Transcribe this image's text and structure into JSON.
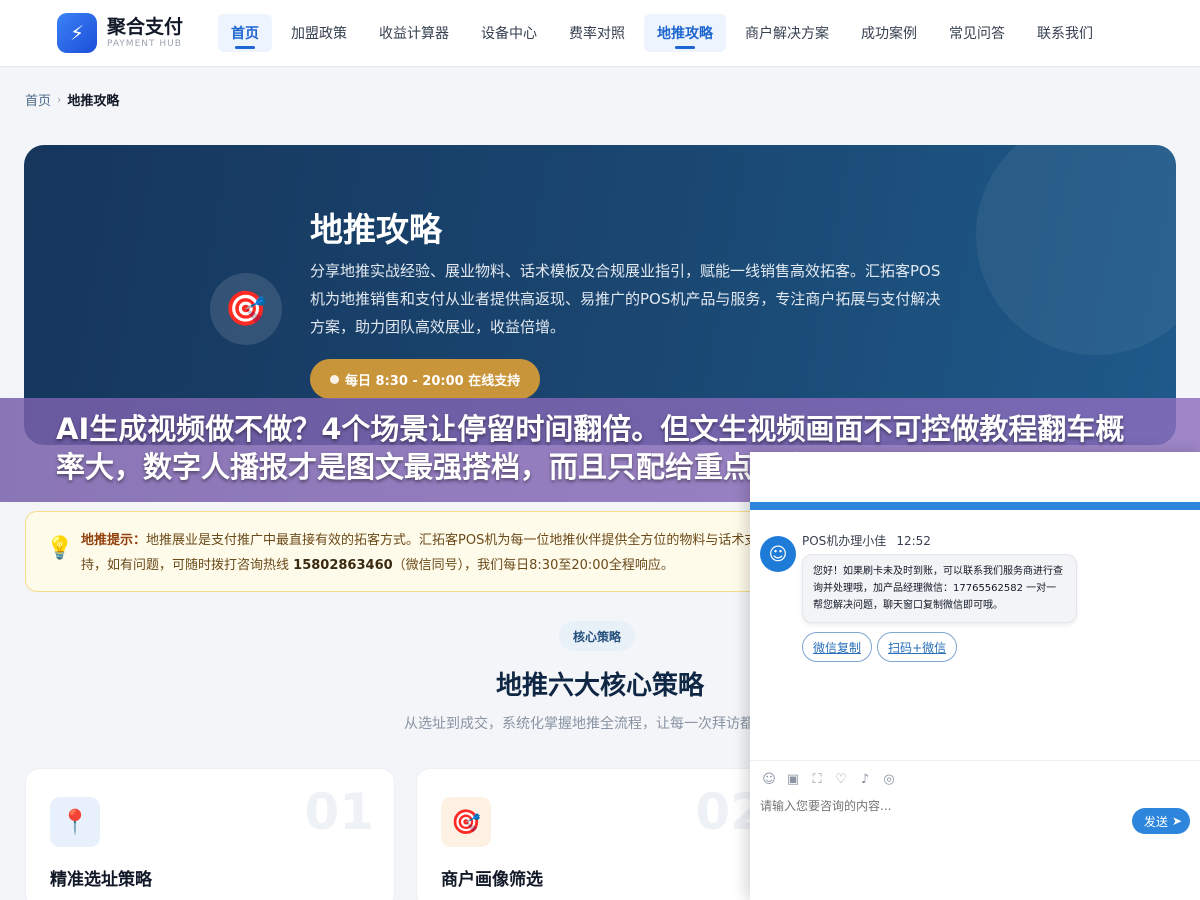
{
  "header": {
    "logo_glyph": "⚡",
    "logo_title": "聚合支付",
    "logo_subtitle": "PAYMENT HUB",
    "nav": [
      {
        "label": "首页",
        "active": true
      },
      {
        "label": "加盟政策"
      },
      {
        "label": "收益计算器"
      },
      {
        "label": "设备中心"
      },
      {
        "label": "费率对照"
      },
      {
        "label": "地推攻略",
        "active": true
      },
      {
        "label": "商户解决方案"
      },
      {
        "label": "成功案例"
      },
      {
        "label": "常见问答"
      },
      {
        "label": "联系我们"
      }
    ]
  },
  "breadcrumb": {
    "home": "首页",
    "separator": "›",
    "current": "地推攻略"
  },
  "hero": {
    "icon": "target-icon",
    "title": "地推攻略",
    "description": "分享地推实战经验、展业物料、话术模板及合规展业指引，赋能一线销售高效拓客。汇拓客POS机为地推销售和支付从业者提供高返现、易推广的POS机产品与服务，专注商户拓展与支付解决方案，助力团队高效展业，收益倍增。",
    "button_label": "每日 8:30 - 20:00 在线支持"
  },
  "overlay": {
    "text": "AI生成视频做不做？4个场景让停留时间翻倍。但文生视频画面不可控做教程翻车概率大，数字人播报才是图文最强搭档，而且只配给重点内容不"
  },
  "notice": {
    "icon": "💡",
    "label": "地推提示：",
    "text_1": "地推展业是支付推广中最直接有效的拓客方式。汇拓客POS机为每一位地推伙伴提供全方位的物料与话术支持，如有问题，可随时拨打咨询热线",
    "phone": "15802863460",
    "text_2": "（微信同号），我们每日8:30至20:00全程响应。"
  },
  "section": {
    "tag": "核心策略",
    "title": "地推六大核心策略",
    "subtitle": "从选址到成交，系统化掌握地推全流程，让每一次拜访都有收获"
  },
  "cards": [
    {
      "num": "01",
      "icon": "📍",
      "title": "精准选址策略"
    },
    {
      "num": "02",
      "icon": "🎯",
      "title": "商户画像筛选"
    }
  ],
  "chat": {
    "close": "✕",
    "agent_avatar": "☺",
    "agent_name": "POS机办理小佳",
    "time": "12:52",
    "message": "您好！如果刷卡未及时到账，可以联系我们服务商进行查询并处理哦，加产品经理微信：17765562582 一对一帮您解决问题，聊天窗口复制微信即可哦。",
    "quick_replies": [
      "微信复制",
      "扫码+微信"
    ],
    "tools": [
      "☺",
      "▣",
      "⛶",
      "♡",
      "♪",
      "◎"
    ],
    "input_placeholder": "请输入您要咨询的内容...",
    "send_label": "发送",
    "send_arrow": "➤"
  },
  "colors": {
    "brand_blue": "#1e66d0",
    "hero_bg": "#1a4772",
    "gold_button": "#c9953a",
    "chat_blue": "#2d86db"
  }
}
